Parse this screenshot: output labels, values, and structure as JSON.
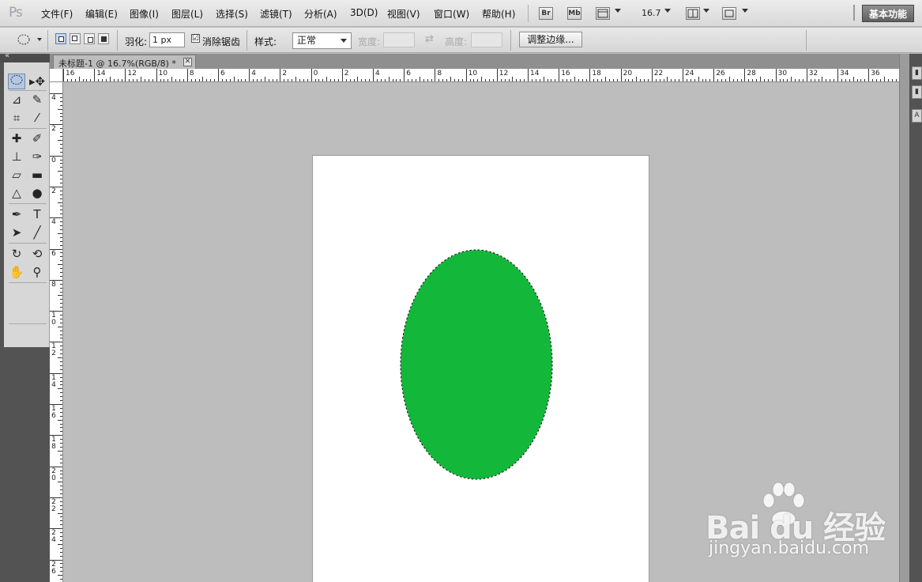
{
  "app": {
    "logo": "Ps"
  },
  "menu": {
    "items": [
      "文件(F)",
      "编辑(E)",
      "图像(I)",
      "图层(L)",
      "选择(S)",
      "滤镜(T)",
      "分析(A)",
      "3D(D)",
      "视图(V)",
      "窗口(W)",
      "帮助(H)"
    ],
    "bridge_label": "Br",
    "minibridge_label": "Mb",
    "zoom": "16.7",
    "workspace": "基本功能"
  },
  "options": {
    "feather_label": "羽化:",
    "feather_value": "1 px",
    "antialias_label": "消除锯齿",
    "antialias_checked": "☑",
    "style_label": "样式:",
    "style_value": "正常",
    "width_label": "宽度:",
    "height_label": "高度:",
    "refine_edge": "调整边缘..."
  },
  "document": {
    "tab_title": "未标题-1 @ 16.7%(RGB/8) *",
    "close_glyph": "✕"
  },
  "rulers": {
    "horizontal": [
      "16",
      "14",
      "12",
      "10",
      "8",
      "6",
      "4",
      "2",
      "0",
      "2",
      "4",
      "6",
      "8",
      "10",
      "12",
      "14",
      "16",
      "18",
      "20",
      "22",
      "24",
      "26",
      "28",
      "30",
      "32",
      "34",
      "36"
    ],
    "vertical": [
      "4",
      "2",
      "0",
      "2",
      "4",
      "6",
      "8",
      "10",
      "12",
      "14",
      "16",
      "18",
      "20",
      "22",
      "24",
      "26"
    ]
  },
  "colors": {
    "foreground": "#16b43c",
    "background": "#ffffff",
    "ellipse_fill": "#13b73a"
  },
  "watermark": {
    "logo": "Bai du 经验",
    "url": "jingyan.baidu.com"
  }
}
